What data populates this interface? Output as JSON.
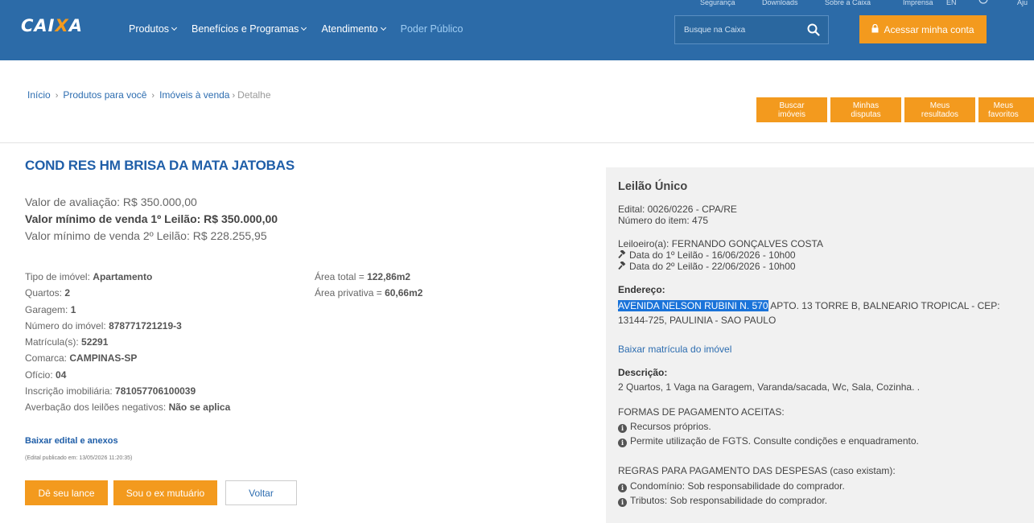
{
  "header": {
    "toplinks": [
      "Segurança",
      "Downloads",
      "Sobre a Caixa",
      "Imprensa",
      "EN",
      "Aju"
    ],
    "logo": {
      "main": "CAI",
      "x": "X",
      "end": "A"
    },
    "nav": [
      "Produtos",
      "Benefícios e Programas",
      "Atendimento",
      "Poder Público"
    ],
    "search_placeholder": "Busque na Caixa",
    "account_label": "Acessar minha conta",
    "colors": {
      "bar": "#2c6ba8",
      "accent": "#f39a1e"
    }
  },
  "breadcrumb": [
    "Início",
    "Produtos para você",
    "Imóveis à venda",
    "Detalhe"
  ],
  "quick_actions": [
    [
      "Buscar",
      "imóveis"
    ],
    [
      "Minhas",
      "disputas"
    ],
    [
      "Meus",
      "resultados"
    ],
    [
      "Meus",
      "favoritos"
    ]
  ],
  "property": {
    "title": "COND RES HM BRISA DA MATA JATOBAS",
    "valor_avaliacao": "Valor de avaliação: R$ 350.000,00",
    "valor_1_leilao": "Valor mínimo de venda 1º Leilão: R$ 350.000,00",
    "valor_2_leilao": "Valor mínimo de venda 2º Leilão: R$ 228.255,95",
    "details": [
      {
        "label": "Tipo de imóvel:",
        "value": "Apartamento"
      },
      {
        "label": "Quartos:",
        "value": "2"
      },
      {
        "label": "Garagem:",
        "value": "1"
      },
      {
        "label": "Número do imóvel:",
        "value": "878771721219-3"
      },
      {
        "label": "Matrícula(s):",
        "value": "52291"
      },
      {
        "label": "Comarca:",
        "value": "CAMPINAS-SP"
      },
      {
        "label": "Ofício:",
        "value": "04"
      },
      {
        "label": "Inscrição imobiliária:",
        "value": "781057706100039"
      },
      {
        "label": "Averbação dos leilões negativos:",
        "value": "Não se aplica"
      }
    ],
    "areas": [
      {
        "label": "Área total =",
        "value": "122,86m2"
      },
      {
        "label": "Área privativa =",
        "value": "60,66m2"
      }
    ],
    "download_label": "Baixar edital e anexos",
    "published": "(Edital publicado em: 13/05/2026 11:20:35)",
    "buttons": {
      "bid": "Dê seu lance",
      "mutuario": "Sou o ex mutuário",
      "back": "Voltar"
    }
  },
  "panel": {
    "title": "Leilão Único",
    "edital": "Edital: 0026/0226 - CPA/RE",
    "item": "Número do item: 475",
    "leiloeiro": "Leiloeiro(a): FERNANDO GONÇALVES COSTA",
    "data1": "Data do 1º Leilão - 16/06/2026 - 10h00",
    "data2": "Data do 2º Leilão - 22/06/2026 - 10h00",
    "endereco_label": "Endereço:",
    "endereco_highlight": "AVENIDA NELSON RUBINI N. 570",
    "endereco_rest": " APTO. 13 TORRE B, BALNEARIO TROPICAL - CEP:",
    "endereco_line2": "13144-725, PAULINIA - SAO PAULO",
    "matricula_link": "Baixar matrícula do imóvel",
    "descricao_label": "Descrição:",
    "descricao": "2 Quartos, 1 Vaga na Garagem, Varanda/sacada, Wc, Sala, Cozinha. .",
    "formas_title": "FORMAS DE PAGAMENTO ACEITAS:",
    "formas": [
      "Recursos próprios.",
      "Permite utilização de FGTS. Consulte condições e enquadramento."
    ],
    "regras_title": "REGRAS PARA PAGAMENTO DAS DESPESAS (caso existam):",
    "regras": [
      "Condomínio: Sob responsabilidade do comprador.",
      "Tributos: Sob responsabilidade do comprador."
    ]
  }
}
